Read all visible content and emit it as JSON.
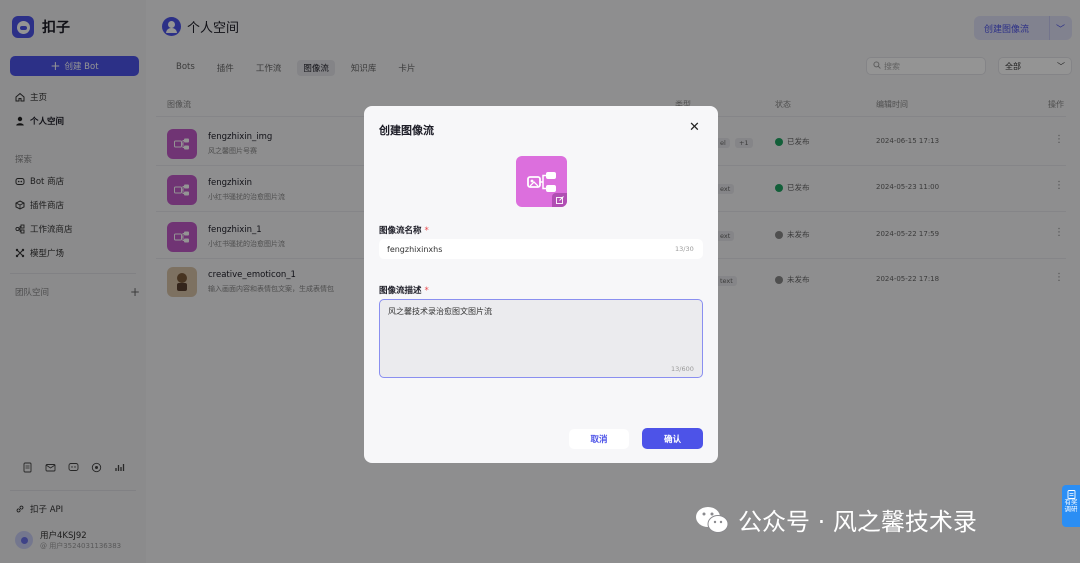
{
  "app": {
    "name": "扣子"
  },
  "sidebar": {
    "create_bot_label": "创建 Bot",
    "nav": [
      {
        "label": "主页",
        "icon": "home-icon"
      },
      {
        "label": "个人空间",
        "icon": "user-icon"
      }
    ],
    "explore_label": "探索",
    "explore_items": [
      {
        "label": "Bot 商店",
        "icon": "bot-store-icon"
      },
      {
        "label": "插件商店",
        "icon": "plugin-store-icon"
      },
      {
        "label": "工作流商店",
        "icon": "workflow-store-icon"
      },
      {
        "label": "模型广场",
        "icon": "model-square-icon"
      }
    ],
    "team_space_label": "团队空间",
    "api_label": "扣子 API",
    "user_name": "用户4KSJ92",
    "user_id": "@ 用户3524031136383"
  },
  "header": {
    "title": "个人空间",
    "create_button": "创建图像流"
  },
  "tabs": [
    "Bots",
    "插件",
    "工作流",
    "图像流",
    "知识库",
    "卡片"
  ],
  "active_tab": "图像流",
  "search": {
    "placeholder": "搜索"
  },
  "filter": {
    "selected": "全部"
  },
  "table": {
    "headers": {
      "name": "图像流",
      "type": "类型",
      "status": "状态",
      "time": "编辑时间",
      "actions": "操作"
    },
    "rows": [
      {
        "name": "fengzhixin_img",
        "desc": "风之馨图片号赛",
        "tag": "el",
        "tag2": "+1",
        "status": "已发布",
        "published": true,
        "time": "2024-06-15 17:13"
      },
      {
        "name": "fengzhixin",
        "desc": "小红书骚扰的治愈图片流",
        "tag": "ext",
        "tag2": "",
        "status": "已发布",
        "published": true,
        "time": "2024-05-23 11:00"
      },
      {
        "name": "fengzhixin_1",
        "desc": "小红书骚扰的治愈图片流",
        "tag": "ext",
        "tag2": "",
        "status": "未发布",
        "published": false,
        "time": "2024-05-22 17:59"
      },
      {
        "name": "creative_emoticon_1",
        "desc": "输入画面内容和表情包文案，生成表情包",
        "tag": "text",
        "tag2": "",
        "status": "未发布",
        "published": false,
        "time": "2024-05-22 17:18"
      }
    ]
  },
  "modal": {
    "title": "创建图像流",
    "name_label": "图像流名称",
    "name_value": "fengzhixinxhs",
    "name_count": "13/30",
    "desc_label": "图像流描述",
    "desc_value": "风之馨技术录治愈图文图片流",
    "desc_count": "13/600",
    "required_mark": "*",
    "cancel": "取消",
    "confirm": "确认"
  },
  "watermark": "公众号 · 风之馨技术录",
  "side_widget": {
    "line1": "有奖",
    "line2": "调研"
  },
  "colors": {
    "accent": "#4d53e8",
    "flow_icon": "#dc6fdd",
    "published": "#1fa462",
    "unpublished": "#888888"
  }
}
